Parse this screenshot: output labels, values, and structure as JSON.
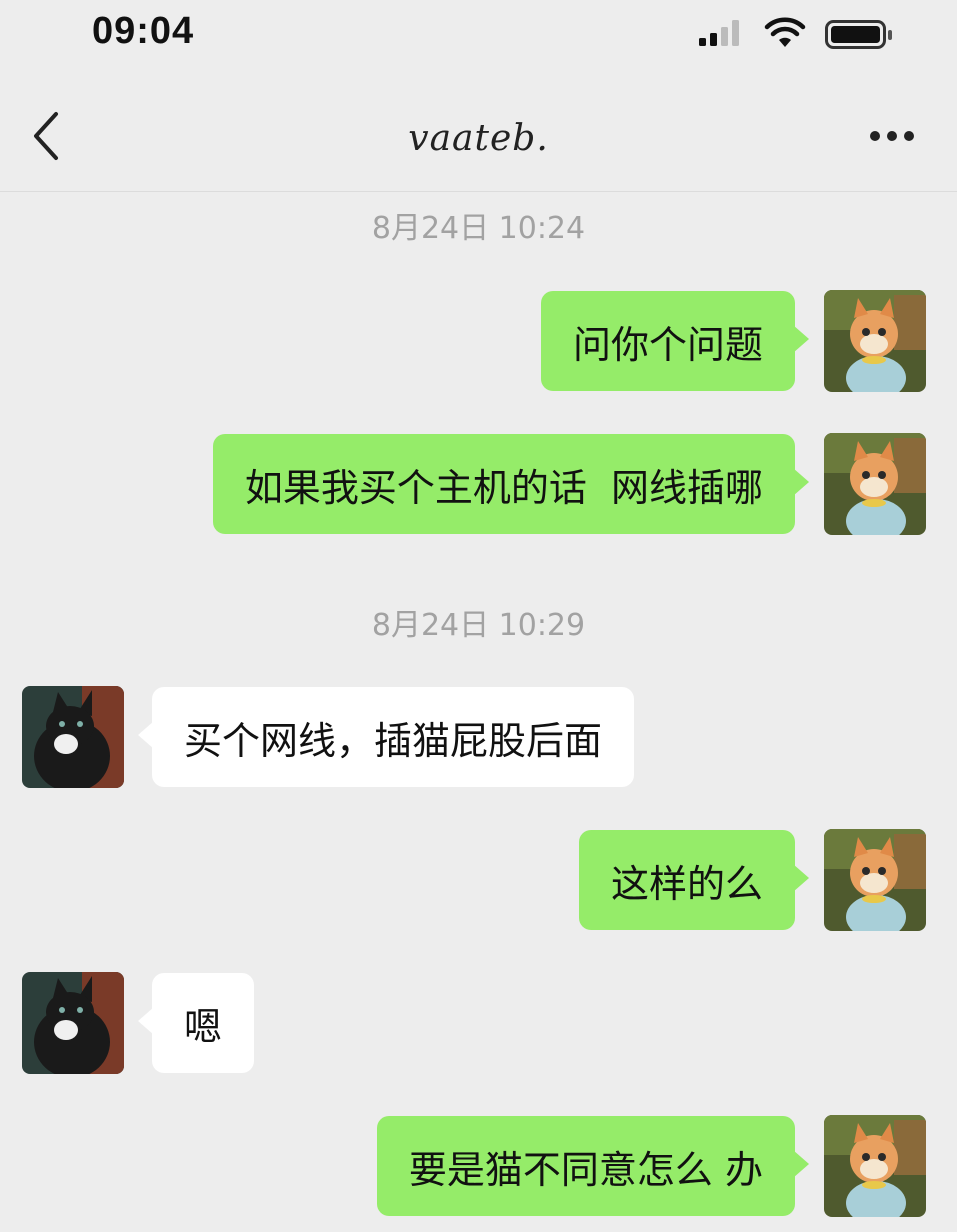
{
  "status_bar": {
    "time": "09:04"
  },
  "header": {
    "title": "vaateb."
  },
  "messages": [
    {
      "type": "timestamp",
      "text": "8月24日 10:24"
    },
    {
      "type": "sent",
      "text": "问你个问题"
    },
    {
      "type": "sent",
      "text": "如果我买个主机的话  网线插哪"
    },
    {
      "type": "timestamp",
      "text": "8月24日 10:29"
    },
    {
      "type": "received",
      "text": "买个网线，插猫屁股后面"
    },
    {
      "type": "sent",
      "text": "这样的么"
    },
    {
      "type": "received",
      "text": "嗯"
    },
    {
      "type": "sent",
      "text": "要是猫不同意怎么 办"
    }
  ],
  "icons": {
    "back": "chevron-left-icon",
    "more": "more-dots-icon",
    "signal": "signal-icon",
    "wifi": "wifi-icon",
    "battery": "battery-icon"
  },
  "colors": {
    "background": "#ededed",
    "sent_bubble": "#95ec69",
    "received_bubble": "#ffffff",
    "timestamp_text": "#a2a2a2"
  }
}
